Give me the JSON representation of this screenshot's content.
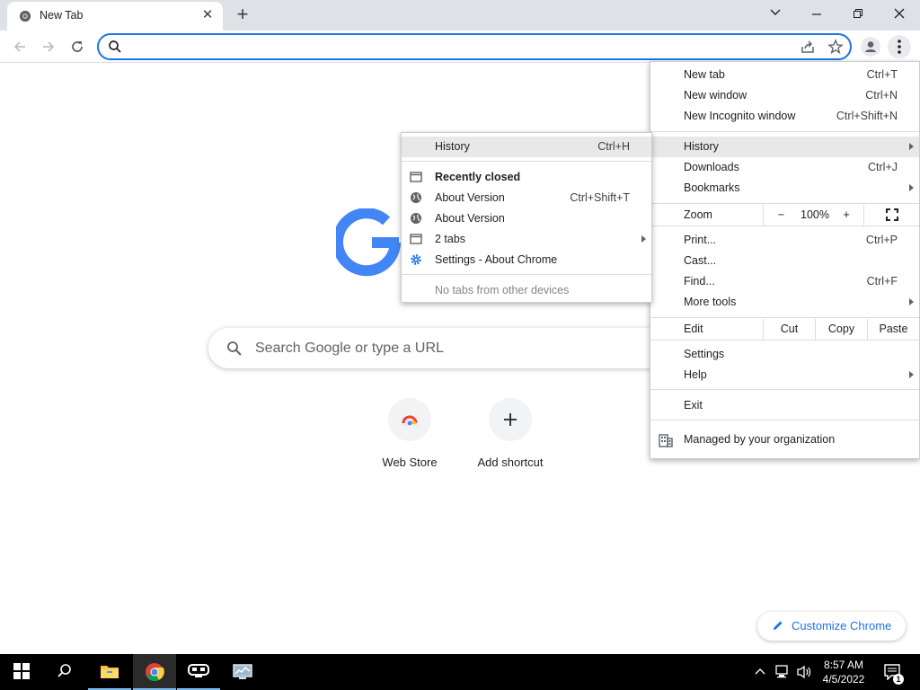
{
  "browser": {
    "tab_title": "New Tab",
    "omnibox_value": "",
    "colors": {
      "accent": "#1a73e8",
      "tabstrip": "#dee1e6"
    }
  },
  "ntp": {
    "search_placeholder": "Search Google or type a URL",
    "shortcuts": [
      {
        "label": "Web Store",
        "icon": "web-store-icon"
      },
      {
        "label": "Add shortcut",
        "icon": "plus-icon"
      }
    ],
    "customize_label": "Customize Chrome"
  },
  "main_menu": {
    "new_tab": {
      "label": "New tab",
      "shortcut": "Ctrl+T"
    },
    "new_window": {
      "label": "New window",
      "shortcut": "Ctrl+N"
    },
    "new_incognito": {
      "label": "New Incognito window",
      "shortcut": "Ctrl+Shift+N"
    },
    "history": {
      "label": "History"
    },
    "downloads": {
      "label": "Downloads",
      "shortcut": "Ctrl+J"
    },
    "bookmarks": {
      "label": "Bookmarks"
    },
    "zoom": {
      "label": "Zoom",
      "minus": "−",
      "value": "100%",
      "plus": "+"
    },
    "print": {
      "label": "Print...",
      "shortcut": "Ctrl+P"
    },
    "cast": {
      "label": "Cast..."
    },
    "find": {
      "label": "Find...",
      "shortcut": "Ctrl+F"
    },
    "more_tools": {
      "label": "More tools"
    },
    "edit": {
      "label": "Edit",
      "cut": "Cut",
      "copy": "Copy",
      "paste": "Paste"
    },
    "settings": {
      "label": "Settings"
    },
    "help": {
      "label": "Help"
    },
    "exit": {
      "label": "Exit"
    },
    "managed": {
      "label": "Managed by your organization"
    }
  },
  "history_menu": {
    "history": {
      "label": "History",
      "shortcut": "Ctrl+H"
    },
    "recently_closed": {
      "label": "Recently closed"
    },
    "items": [
      {
        "label": "About Version",
        "shortcut": "Ctrl+Shift+T",
        "icon": "globe-icon"
      },
      {
        "label": "About Version",
        "shortcut": "",
        "icon": "globe-icon"
      },
      {
        "label": "2 tabs",
        "shortcut": "",
        "icon": "window-icon"
      },
      {
        "label": "Settings - About Chrome",
        "shortcut": "",
        "icon": "gear-icon"
      }
    ],
    "no_tabs": {
      "label": "No tabs from other devices"
    }
  },
  "taskbar": {
    "time": "8:57 AM",
    "date": "4/5/2022",
    "notification_count": "1"
  }
}
